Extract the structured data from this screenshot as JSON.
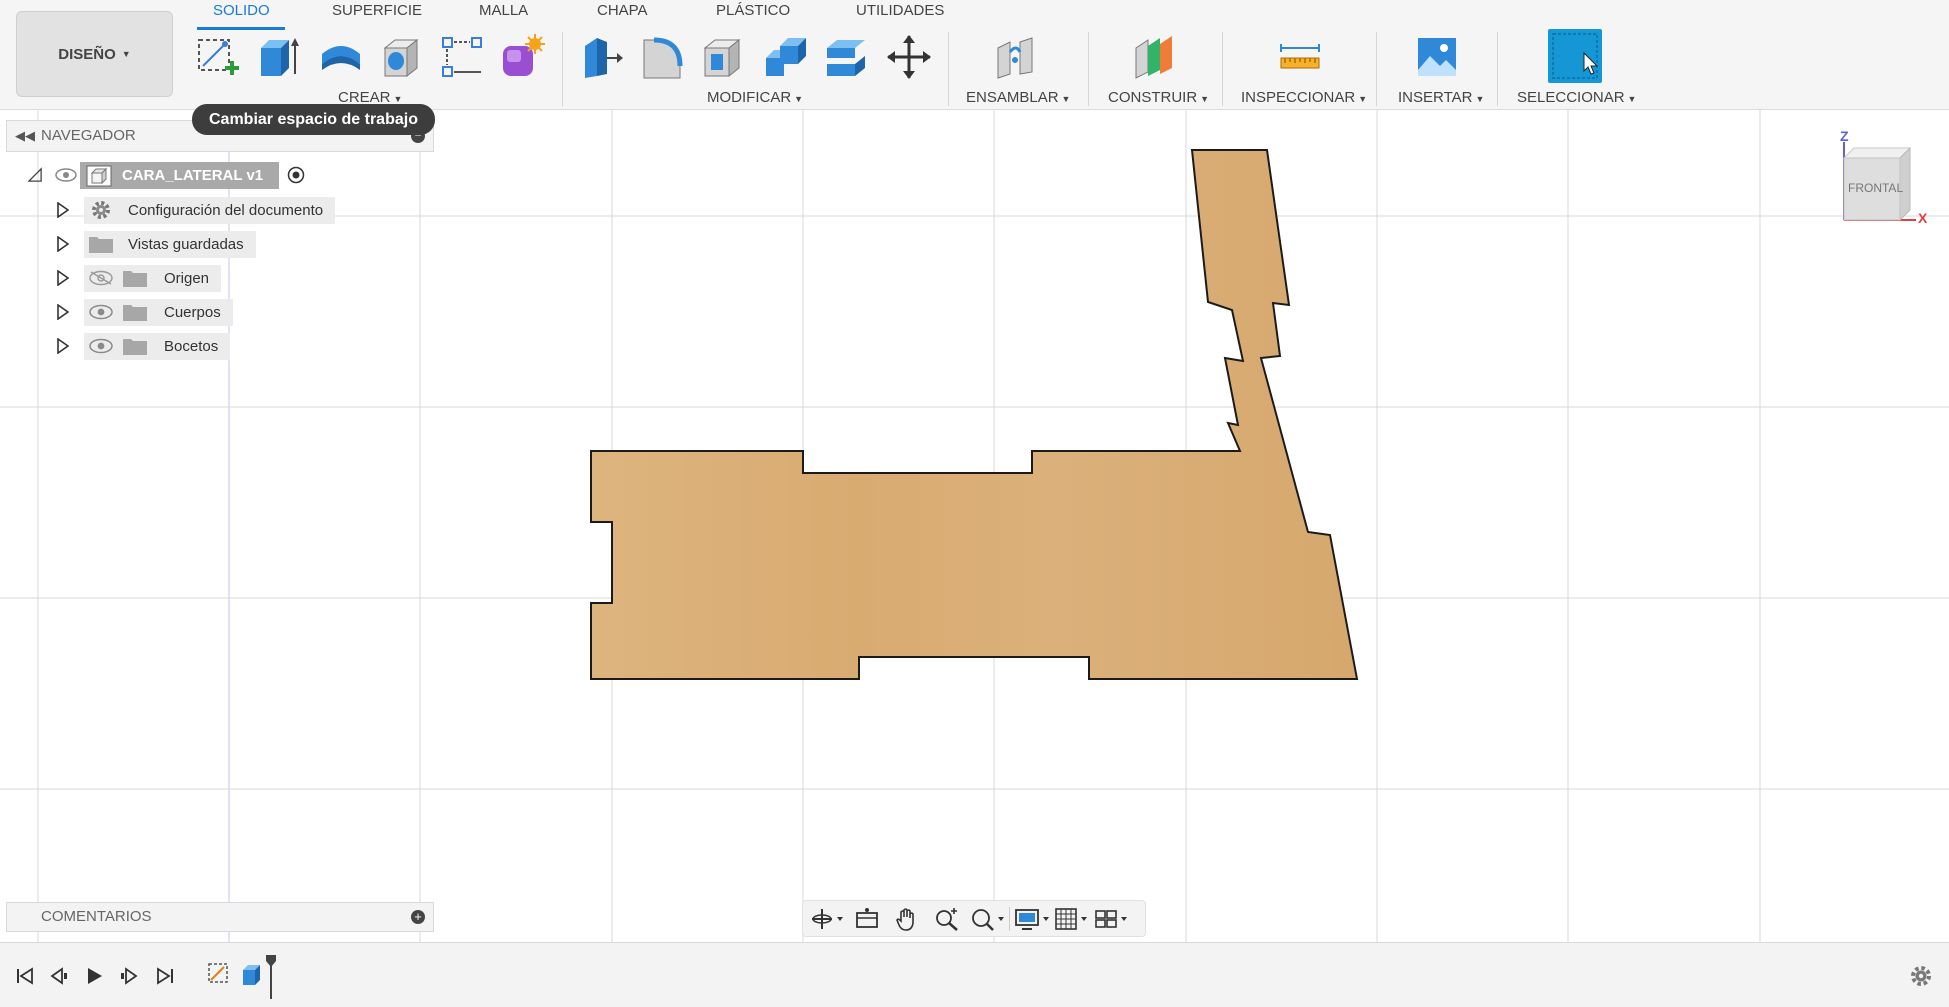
{
  "workspace": {
    "label": "DISEÑO"
  },
  "tabs": [
    {
      "label": "SOLIDO",
      "active": true
    },
    {
      "label": "SUPERFICIE",
      "active": false
    },
    {
      "label": "MALLA",
      "active": false
    },
    {
      "label": "CHAPA",
      "active": false
    },
    {
      "label": "PLÁSTICO",
      "active": false
    },
    {
      "label": "UTILIDADES",
      "active": false
    }
  ],
  "groups": {
    "crear": "CREAR",
    "modificar": "MODIFICAR",
    "ensamblar": "ENSAMBLAR",
    "construir": "CONSTRUIR",
    "inspeccionar": "INSPECCIONAR",
    "insertar": "INSERTAR",
    "seleccionar": "SELECCIONAR"
  },
  "tooltip": "Cambiar espacio de trabajo",
  "navigator": {
    "title": "NAVEGADOR",
    "root": "CARA_LATERAL v1",
    "items": [
      {
        "label": "Configuración del documento",
        "icon": "gear-icon"
      },
      {
        "label": "Vistas guardadas",
        "icon": "folder-icon"
      },
      {
        "label": "Origen",
        "icon": "folder-icon",
        "visibility": "hidden"
      },
      {
        "label": "Cuerpos",
        "icon": "folder-icon",
        "visibility": "visible"
      },
      {
        "label": "Bocetos",
        "icon": "folder-icon",
        "visibility": "visible"
      }
    ]
  },
  "comments": {
    "title": "COMENTARIOS"
  },
  "viewcube": {
    "face": "FRONTAL",
    "axis_z": "Z",
    "axis_x": "X"
  },
  "colors": {
    "accent": "#1a7bd6",
    "wood": "#d9ac72",
    "grid": "#d8d8d8",
    "select_button": "#1597d6"
  }
}
